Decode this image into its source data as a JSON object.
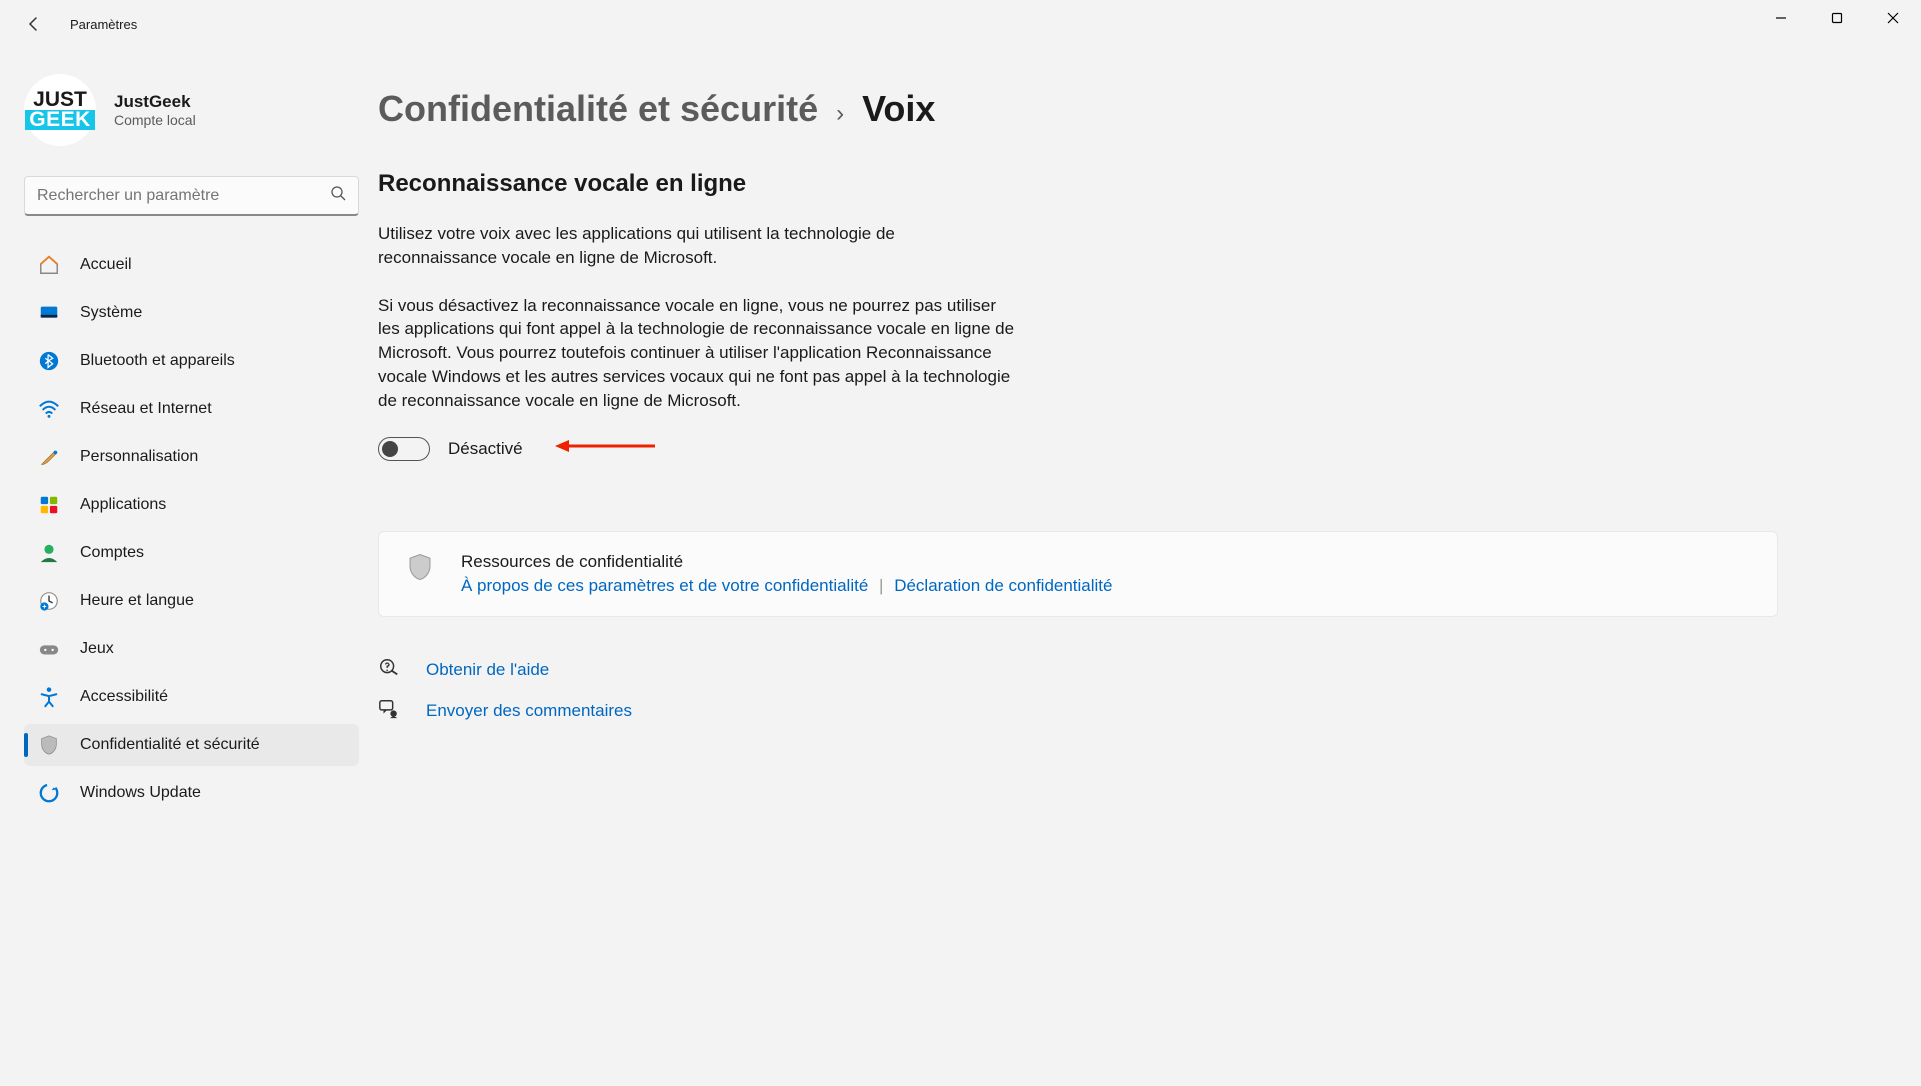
{
  "window": {
    "title": "Paramètres"
  },
  "profile": {
    "name": "JustGeek",
    "subtitle": "Compte local",
    "avatar_line1": "JUST",
    "avatar_line2": "GEEK"
  },
  "search": {
    "placeholder": "Rechercher un paramètre"
  },
  "sidebar": {
    "items": [
      {
        "label": "Accueil",
        "icon": "home"
      },
      {
        "label": "Système",
        "icon": "system"
      },
      {
        "label": "Bluetooth et appareils",
        "icon": "bluetooth"
      },
      {
        "label": "Réseau et Internet",
        "icon": "wifi"
      },
      {
        "label": "Personnalisation",
        "icon": "brush"
      },
      {
        "label": "Applications",
        "icon": "apps"
      },
      {
        "label": "Comptes",
        "icon": "person"
      },
      {
        "label": "Heure et langue",
        "icon": "clock"
      },
      {
        "label": "Jeux",
        "icon": "gamepad"
      },
      {
        "label": "Accessibilité",
        "icon": "accessibility"
      },
      {
        "label": "Confidentialité et sécurité",
        "icon": "shield",
        "active": true
      },
      {
        "label": "Windows Update",
        "icon": "update"
      }
    ]
  },
  "breadcrumb": {
    "parent": "Confidentialité et sécurité",
    "current": "Voix"
  },
  "main": {
    "heading": "Reconnaissance vocale en ligne",
    "para1": "Utilisez votre voix avec les applications qui utilisent la technologie de reconnaissance vocale en ligne de Microsoft.",
    "para2": "Si vous désactivez la reconnaissance vocale en ligne, vous ne pourrez pas utiliser les applications qui font appel à la technologie de reconnaissance vocale en ligne de Microsoft. Vous pourrez toutefois continuer à utiliser l'application Reconnaissance vocale Windows et les autres services vocaux qui ne font pas appel à la technologie de reconnaissance vocale en ligne de Microsoft.",
    "toggle_label": "Désactivé",
    "toggle_state": "off"
  },
  "card": {
    "title": "Ressources de confidentialité",
    "link1": "À propos de ces paramètres et de votre confidentialité",
    "link2": "Déclaration de confidentialité"
  },
  "footer": {
    "help": "Obtenir de l'aide",
    "feedback": "Envoyer des commentaires"
  }
}
